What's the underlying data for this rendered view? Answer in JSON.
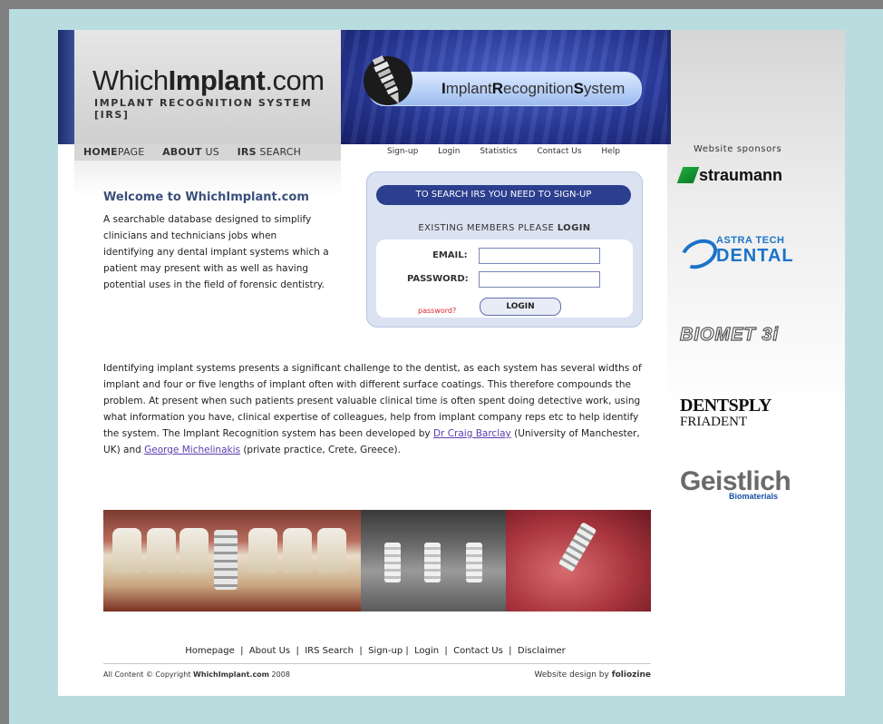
{
  "header": {
    "logo_left": "Which",
    "logo_bold": "Implant",
    "logo_right": ".com",
    "logo_subtitle": "IMPLANT RECOGNITION SYSTEM [IRS]",
    "irs_i": "I",
    "irs_mplant": "mplant",
    "irs_r": "R",
    "irs_ecognition": "ecognition",
    "irs_s": "S",
    "irs_ystem": "ystem"
  },
  "left_nav": {
    "home_bold": "HOME",
    "home_rest": "PAGE",
    "about_bold": "ABOUT",
    "about_rest": " US",
    "irs_bold": "IRS",
    "irs_rest": " SEARCH"
  },
  "top_nav": [
    "Sign-up",
    "Login",
    "Statistics",
    "Contact Us",
    "Help"
  ],
  "welcome": {
    "title": "Welcome to WhichImplant.com",
    "text": "A searchable database designed to simplify clinicians and technicians jobs when identifying any dental implant systems which a patient may present with as well as having potential uses in the field of forensic dentistry."
  },
  "login": {
    "signup_banner": "TO SEARCH IRS YOU NEED TO SIGN-UP",
    "existing_prefix": "EXISTING MEMBERS PLEASE ",
    "existing_login": "LOGIN",
    "email_label": "EMAIL:",
    "password_label": "PASSWORD:",
    "email_value": "",
    "password_value": "",
    "forgot_link": "password?",
    "login_button": "LOGIN"
  },
  "body": {
    "paragraph_a": "Identifying implant systems presents a significant challenge to the dentist, as each system has several widths of implant and four or five lengths of implant often with different surface coatings. This therefore compounds the problem. At present when such patients present valuable clinical time is often spent doing detective work, using what information you have, clinical expertise of colleagues, help from implant company reps etc to help identify the system. The Implant Recognition system has been developed by ",
    "link1": "Dr Craig Barclay",
    "paragraph_b": " (University of Manchester, UK) and ",
    "link2": "George Michelinakis",
    "paragraph_c": " (private practice, Crete, Greece)."
  },
  "sponsors": {
    "title": "Website sponsors",
    "straumann": "straumann",
    "astra_1": "ASTRA TECH",
    "astra_2": "DENTAL",
    "biomet": "BIOMET 3i",
    "dentsply_1": "DENTSPLY",
    "dentsply_2": "FRIADENT",
    "geistlich_1": "Geistlich",
    "geistlich_2": "Biomaterials"
  },
  "footer": {
    "links": [
      "Homepage",
      "About Us",
      "IRS Search",
      "Sign-up",
      "Login",
      "Contact Us",
      "Disclaimer"
    ],
    "copyright_prefix": "All Content © Copyright ",
    "copyright_site": "WhichImplant.com",
    "copyright_year": " 2008",
    "design_prefix": "Website design by ",
    "design_name": "foliozine"
  },
  "colors": {
    "background": "#b9dcdf",
    "frame": "#808080",
    "accent": "#2c3e8e",
    "link": "#5a3db0",
    "forgot": "#dd2233"
  }
}
